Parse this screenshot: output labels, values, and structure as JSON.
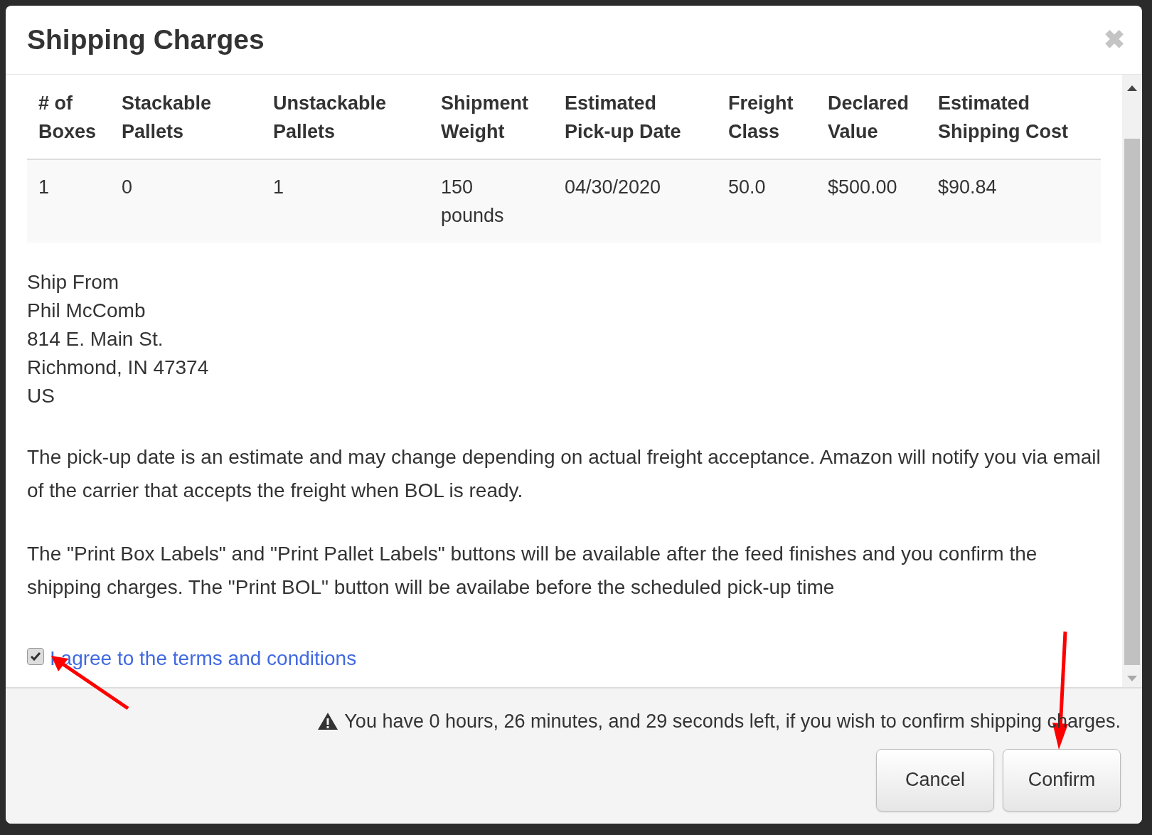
{
  "dialog": {
    "title": "Shipping Charges",
    "close_label": "✖"
  },
  "table": {
    "columns": [
      "# of Boxes",
      "Stackable Pallets",
      "Unstackable Pallets",
      "Shipment Weight",
      "Estimated Pick-up Date",
      "Freight Class",
      "Declared Value",
      "Estimated Shipping Cost"
    ],
    "rows": [
      [
        "1",
        "0",
        "1",
        "150 pounds",
        "04/30/2020",
        "50.0",
        "$500.00",
        "$90.84"
      ]
    ]
  },
  "ship_from": [
    "Ship From",
    "Phil McComb",
    "814 E. Main St.",
    "Richmond, IN 47374",
    "US"
  ],
  "notes": [
    "The pick-up date is an estimate and may change depending on actual freight acceptance. Amazon will notify you via email of the carrier that accepts the freight when BOL is ready.",
    "The \"Print Box Labels\" and \"Print Pallet Labels\" buttons will be available after the feed finishes and you confirm the shipping charges. The \"Print BOL\" button will be availabe before the scheduled pick-up time"
  ],
  "agree": {
    "label": "I agree to the terms and conditions",
    "checked": true
  },
  "footer": {
    "warning": "You have 0 hours, 26 minutes, and 29 seconds left, if you wish to confirm shipping charges.",
    "buttons": [
      "Cancel",
      "Confirm"
    ]
  }
}
